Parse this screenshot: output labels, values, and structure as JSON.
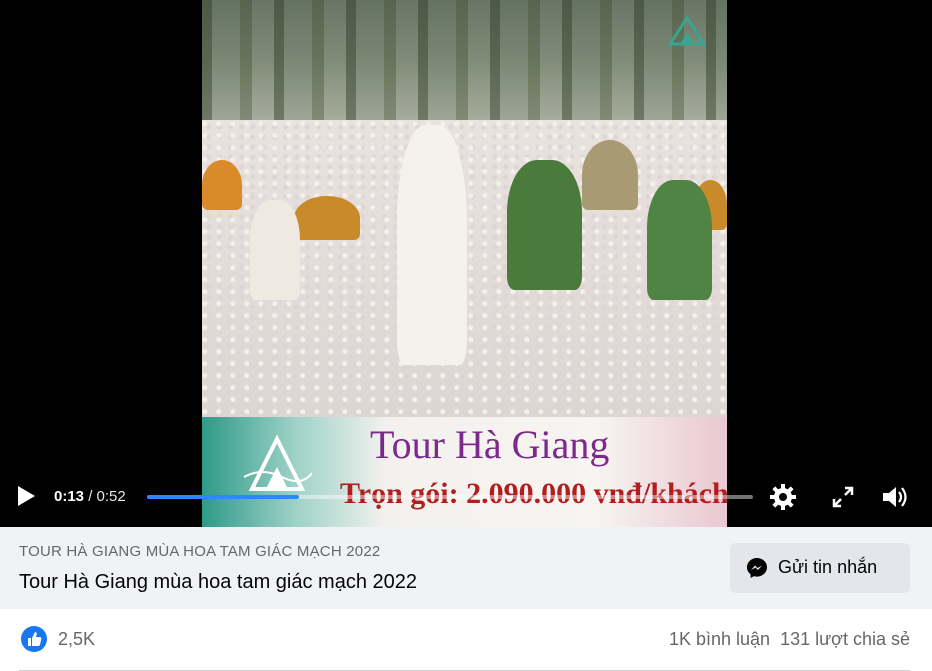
{
  "video": {
    "overlay_title": "Tour Hà Giang",
    "overlay_subtitle": "Trọn gói: 2.090.000 vnđ/khách",
    "current_time": "0:13",
    "separator": "/",
    "duration": "0:52",
    "progress_fraction": 0.25,
    "accent_color": "#2d88ff"
  },
  "post": {
    "caption_small": "TOUR HÀ GIANG MÙA HOA TAM GIÁC MẠCH 2022",
    "caption_title": "Tour Hà Giang mùa hoa tam giác mạch 2022",
    "message_button": "Gửi tin nhắn"
  },
  "reactions": {
    "like_count": "2,5K",
    "comments": "1K bình luận",
    "shares": "131 lượt chia sẻ"
  },
  "icons": {
    "play": "play-icon",
    "settings": "gear-icon",
    "fullscreen": "fullscreen-icon",
    "volume": "volume-icon",
    "messenger": "messenger-icon",
    "like": "thumbs-up-icon"
  }
}
